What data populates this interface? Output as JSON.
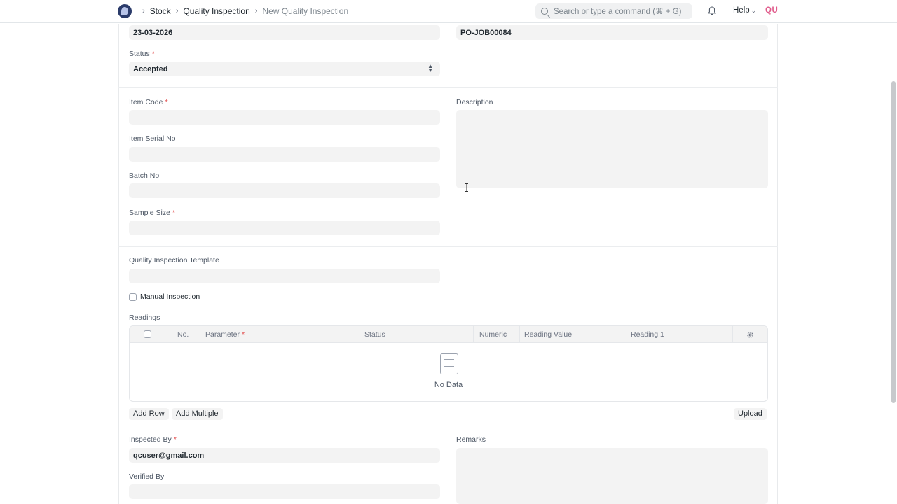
{
  "navbar": {
    "breadcrumbs": [
      "Stock",
      "Quality Inspection",
      "New Quality Inspection"
    ],
    "search_placeholder": "Search or type a command (⌘ + G)",
    "help_label": "Help",
    "avatar_initials": "QU"
  },
  "form": {
    "report_date_value": "23-03-2026",
    "reference_value": "PO-JOB00084",
    "status": {
      "label": "Status",
      "value": "Accepted"
    },
    "item_code_label": "Item Code",
    "description_label": "Description",
    "item_serial_label": "Item Serial No",
    "batch_no_label": "Batch No",
    "sample_size_label": "Sample Size",
    "template_label": "Quality Inspection Template",
    "manual_inspection_label": "Manual Inspection",
    "readings": {
      "label": "Readings",
      "columns": [
        "No.",
        "Parameter",
        "Status",
        "Numeric",
        "Reading Value",
        "Reading 1"
      ],
      "empty_text": "No Data",
      "add_row": "Add Row",
      "add_multiple": "Add Multiple",
      "upload": "Upload"
    },
    "inspected_by": {
      "label": "Inspected By",
      "value": "qcuser@gmail.com"
    },
    "remarks_label": "Remarks",
    "verified_by_label": "Verified By"
  },
  "colors": {
    "required": "#e24c4c",
    "avatar": "#e05b8b",
    "field_bg": "#f3f3f3"
  }
}
